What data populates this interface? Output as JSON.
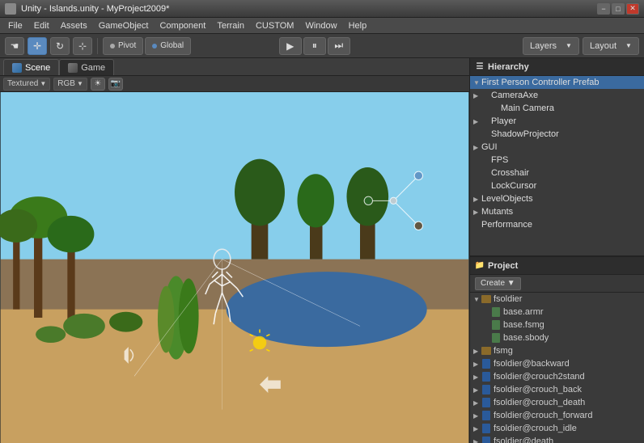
{
  "titleBar": {
    "title": "Unity - Islands.unity - MyProject2009*",
    "icon": "unity-icon",
    "buttons": {
      "minimize": "−",
      "maximize": "□",
      "close": "✕"
    }
  },
  "menuBar": {
    "items": [
      "File",
      "Edit",
      "Assets",
      "GameObject",
      "Component",
      "Terrain",
      "CUSTOM",
      "Window",
      "Help"
    ]
  },
  "toolbar": {
    "tools": [
      {
        "name": "hand-tool",
        "icon": "✋",
        "active": false
      },
      {
        "name": "move-tool",
        "icon": "✛",
        "active": false
      },
      {
        "name": "rotate-tool",
        "icon": "↻",
        "active": false
      },
      {
        "name": "scale-tool",
        "icon": "⊞",
        "active": false
      }
    ],
    "pivot": "Pivot",
    "global": "Global",
    "playControls": {
      "play": "▶",
      "pause": "⏸",
      "step": "⏭"
    },
    "layers": "Layers",
    "layout": "Layout"
  },
  "scenePanel": {
    "tabs": [
      {
        "name": "scene-tab",
        "label": "Scene",
        "active": true
      },
      {
        "name": "game-tab",
        "label": "Game",
        "active": false
      }
    ],
    "toolbar": {
      "shading": "Textured",
      "colorSpace": "RGB"
    }
  },
  "hierarchy": {
    "title": "Hierarchy",
    "items": [
      {
        "level": 0,
        "label": "First Person Controller Prefab",
        "arrow": "▼",
        "selected": true
      },
      {
        "level": 1,
        "label": "CameraAxe",
        "arrow": "▶"
      },
      {
        "level": 2,
        "label": "Main Camera",
        "arrow": ""
      },
      {
        "level": 1,
        "label": "Player",
        "arrow": "▶"
      },
      {
        "level": 1,
        "label": "ShadowProjector",
        "arrow": ""
      },
      {
        "level": 0,
        "label": "GUI",
        "arrow": "▶"
      },
      {
        "level": 1,
        "label": "FPS",
        "arrow": ""
      },
      {
        "level": 1,
        "label": "Crosshair",
        "arrow": ""
      },
      {
        "level": 1,
        "label": "LockCursor",
        "arrow": ""
      },
      {
        "level": 0,
        "label": "LevelObjects",
        "arrow": "▶"
      },
      {
        "level": 0,
        "label": "Mutants",
        "arrow": "▶"
      },
      {
        "level": 0,
        "label": "Performance",
        "arrow": ""
      }
    ]
  },
  "project": {
    "title": "Project",
    "createBtn": "Create ▼",
    "items": [
      {
        "level": 0,
        "label": "fsoldier",
        "arrow": "▼",
        "type": "folder"
      },
      {
        "level": 1,
        "label": "base.armr",
        "arrow": "",
        "type": "file-mesh"
      },
      {
        "level": 1,
        "label": "base.fsmg",
        "arrow": "",
        "type": "file-mesh"
      },
      {
        "level": 1,
        "label": "base.sbody",
        "arrow": "",
        "type": "file-mesh"
      },
      {
        "level": 0,
        "label": "fsmg",
        "arrow": "▶",
        "type": "folder"
      },
      {
        "level": 0,
        "label": "fsoldier@backward",
        "arrow": "▶",
        "type": "file-anim"
      },
      {
        "level": 0,
        "label": "fsoldier@crouch2stand",
        "arrow": "▶",
        "type": "file-anim"
      },
      {
        "level": 0,
        "label": "fsoldier@crouch_back",
        "arrow": "▶",
        "type": "file-anim"
      },
      {
        "level": 0,
        "label": "fsoldier@crouch_death",
        "arrow": "▶",
        "type": "file-anim"
      },
      {
        "level": 0,
        "label": "fsoldier@crouch_forward",
        "arrow": "▶",
        "type": "file-anim"
      },
      {
        "level": 0,
        "label": "fsoldier@crouch_idle",
        "arrow": "▶",
        "type": "file-anim"
      },
      {
        "level": 0,
        "label": "fsoldier@death",
        "arrow": "▶",
        "type": "file-anim"
      }
    ]
  }
}
